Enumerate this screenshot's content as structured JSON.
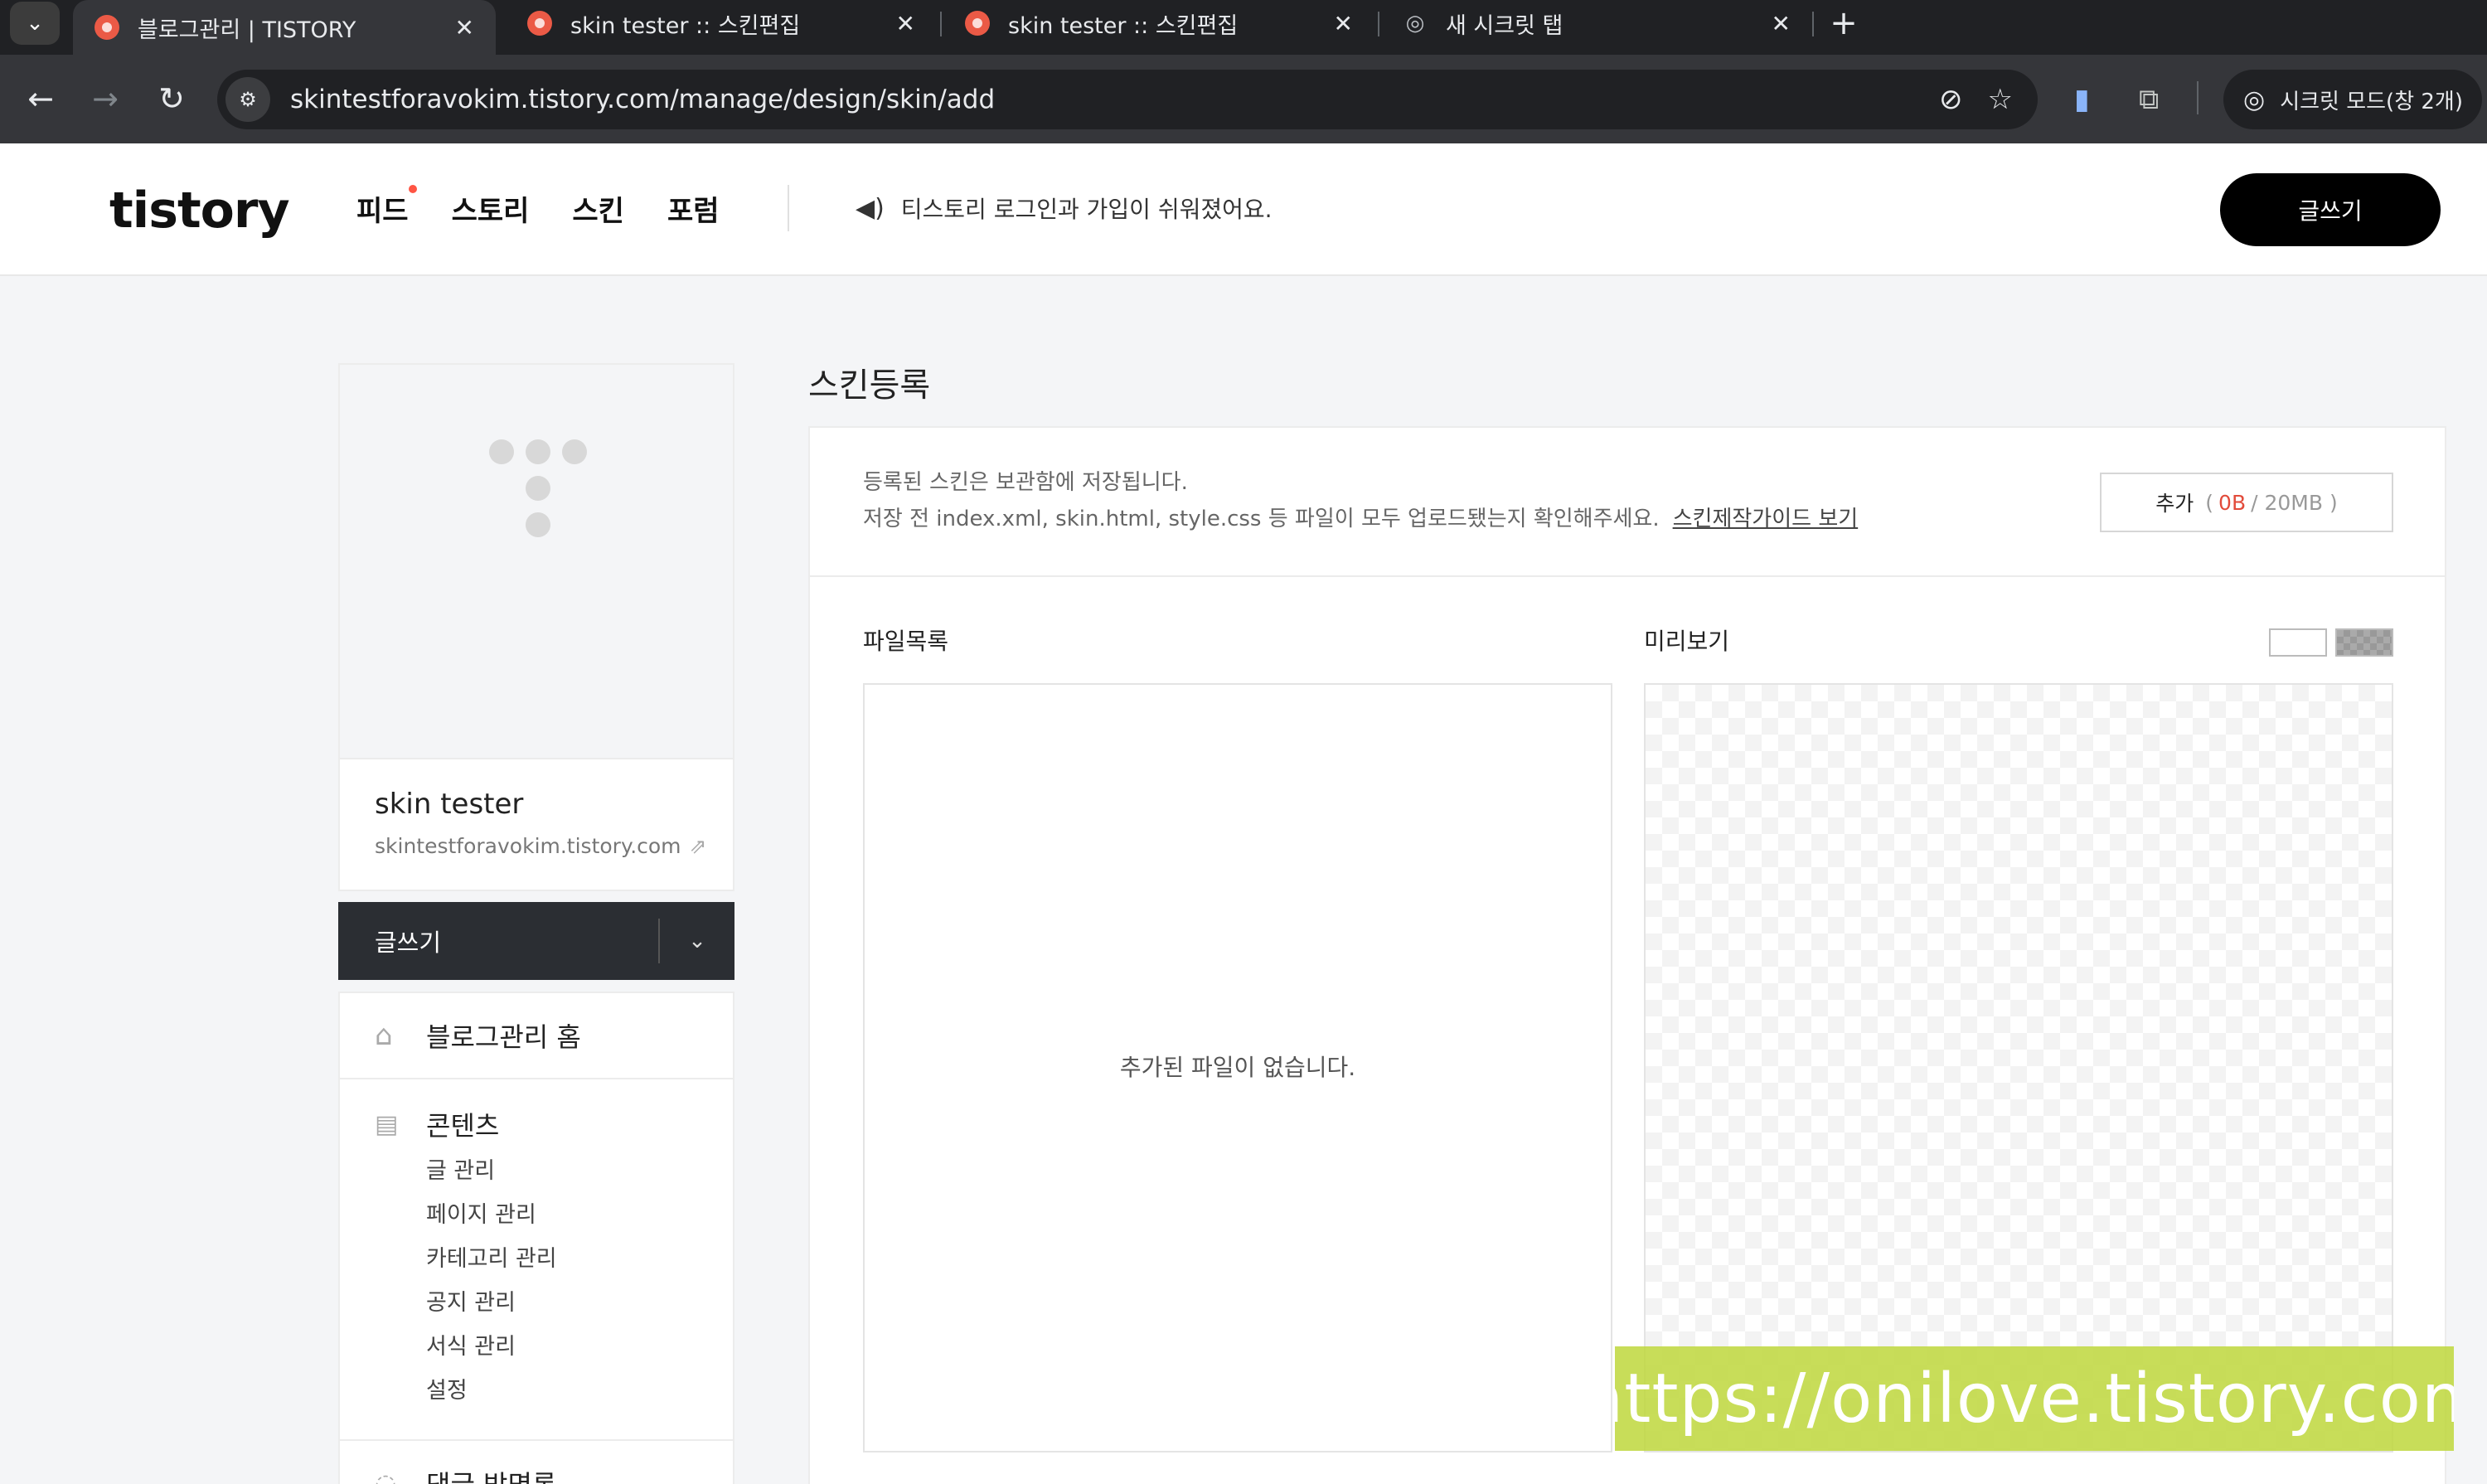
{
  "browser": {
    "tabs": [
      {
        "title": "블로그관리 | TISTORY",
        "close": "✕"
      },
      {
        "title": "skin tester :: 스킨편집",
        "close": "✕"
      },
      {
        "title": "skin tester :: 스킨편집",
        "close": "✕"
      },
      {
        "title": "새 시크릿 탭",
        "close": "✕"
      }
    ],
    "url": "skintestforavokim.tistory.com/manage/design/skin/add",
    "incognito_label": "시크릿 모드(창 2개)"
  },
  "header": {
    "logo": "tistory",
    "nav": [
      {
        "label": "피드"
      },
      {
        "label": "스토리"
      },
      {
        "label": "스킨"
      },
      {
        "label": "포럼"
      }
    ],
    "notice": "티스토리 로그인과 가입이 쉬워졌어요.",
    "write_label": "글쓰기"
  },
  "sidebar": {
    "blog_name": "skin tester",
    "blog_url": "skintestforavokim.tistory.com",
    "write_label": "글쓰기",
    "home_label": "블로그관리 홈",
    "contents_label": "콘텐츠",
    "contents_items": [
      {
        "label": "글 관리"
      },
      {
        "label": "페이지 관리"
      },
      {
        "label": "카테고리 관리"
      },
      {
        "label": "공지 관리"
      },
      {
        "label": "서식 관리"
      },
      {
        "label": "설정"
      }
    ],
    "comments_label": "댓글 방명록"
  },
  "main": {
    "title": "스킨등록",
    "info_line1": "등록된 스킨은 보관함에 저장됩니다.",
    "info_line2": "저장 전 index.xml, skin.html, style.css 등 파일이 모두 업로드됐는지 확인해주세요.",
    "guide_link": "스킨제작가이드 보기",
    "add_button": {
      "label": "추가",
      "used": "0B",
      "total": "/ 20MB )",
      "open": "("
    },
    "files_label": "파일목록",
    "preview_label": "미리보기",
    "empty_message": "추가된 파일이 없습니다."
  },
  "watermark": "https://onilove.tistory.com",
  "colors": {
    "accent_red": "#e24b3b",
    "favicon": "#eb5a46",
    "watermark_bg": "#bed73c"
  }
}
